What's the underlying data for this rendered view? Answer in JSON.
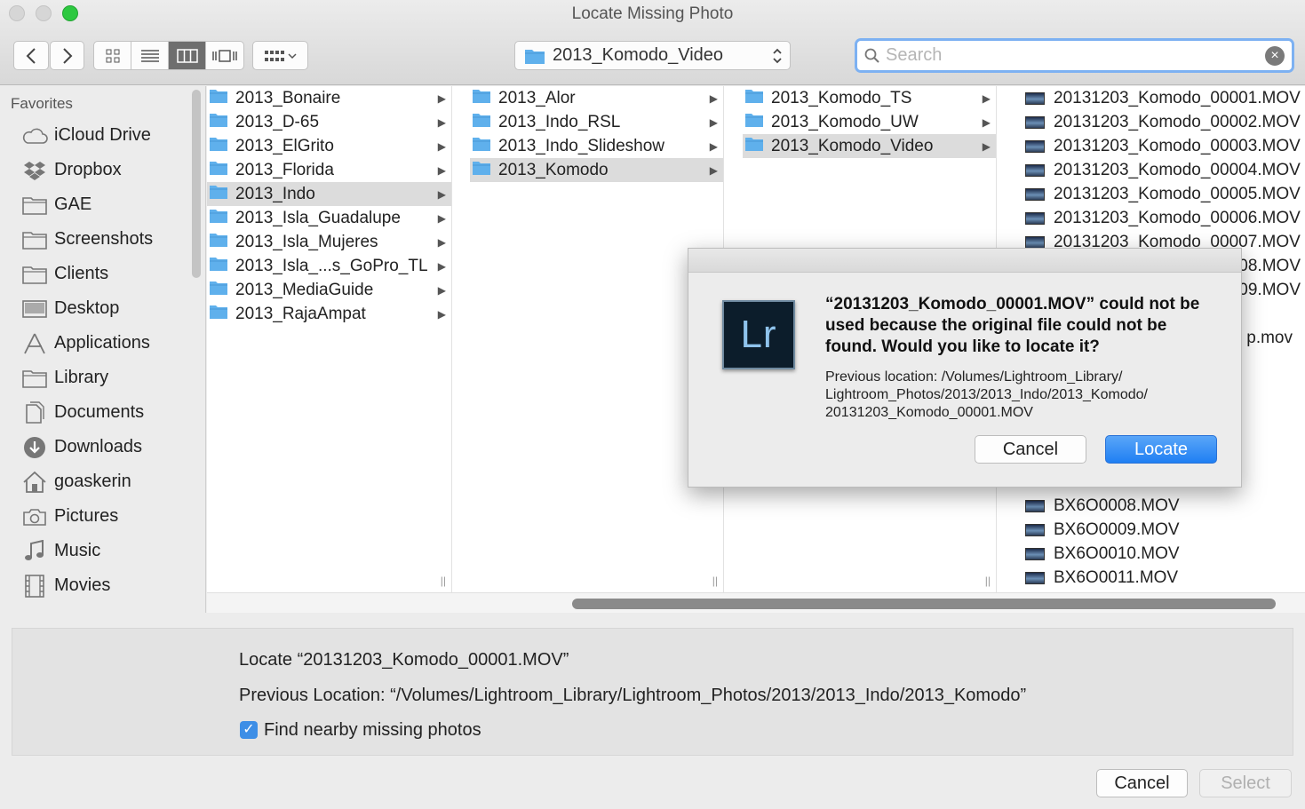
{
  "window": {
    "title": "Locate Missing Photo"
  },
  "toolbar": {
    "back_icon": "chevron-left-icon",
    "forward_icon": "chevron-right-icon",
    "path_popup": "2013_Komodo_Video",
    "search_placeholder": "Search"
  },
  "sidebar": {
    "title": "Favorites",
    "items": [
      {
        "label": "iCloud Drive",
        "icon": "cloud-icon"
      },
      {
        "label": "Dropbox",
        "icon": "dropbox-icon"
      },
      {
        "label": "GAE",
        "icon": "folder-icon"
      },
      {
        "label": "Screenshots",
        "icon": "folder-icon"
      },
      {
        "label": "Clients",
        "icon": "folder-icon"
      },
      {
        "label": "Desktop",
        "icon": "desktop-icon"
      },
      {
        "label": "Applications",
        "icon": "applications-icon"
      },
      {
        "label": "Library",
        "icon": "folder-icon"
      },
      {
        "label": "Documents",
        "icon": "documents-icon"
      },
      {
        "label": "Downloads",
        "icon": "downloads-icon"
      },
      {
        "label": "goaskerin",
        "icon": "home-icon"
      },
      {
        "label": "Pictures",
        "icon": "camera-icon"
      },
      {
        "label": "Music",
        "icon": "music-icon"
      },
      {
        "label": "Movies",
        "icon": "film-icon"
      }
    ]
  },
  "columns": {
    "col1": [
      "2013_Bonaire",
      "2013_D-65",
      "2013_ElGrito",
      "2013_Florida",
      "2013_Indo",
      "2013_Isla_Guadalupe",
      "2013_Isla_Mujeres",
      "2013_Isla_...s_GoPro_TL",
      "2013_MediaGuide",
      "2013_RajaAmpat"
    ],
    "col2": [
      "2013_Alor",
      "2013_Indo_RSL",
      "2013_Indo_Slideshow",
      "2013_Komodo"
    ],
    "col3": [
      "2013_Komodo_TS",
      "2013_Komodo_UW",
      "2013_Komodo_Video"
    ],
    "col4_top": [
      "20131203_Komodo_00001.MOV",
      "20131203_Komodo_00002.MOV",
      "20131203_Komodo_00003.MOV",
      "20131203_Komodo_00004.MOV",
      "20131203_Komodo_00005.MOV",
      "20131203_Komodo_00006.MOV",
      "20131203_Komodo_00007.MOV"
    ],
    "col4_partial": [
      "08.MOV",
      "09.MOV",
      "p.mov"
    ],
    "col4_bottom": [
      "BX6O0008.MOV",
      "BX6O0009.MOV",
      "BX6O0010.MOV",
      "BX6O0011.MOV"
    ],
    "selected": {
      "col1": "2013_Indo",
      "col2": "2013_Komodo",
      "col3": "2013_Komodo_Video"
    }
  },
  "accessory": {
    "locate_line": "Locate “20131203_Komodo_00001.MOV”",
    "previous_line": "Previous Location: “/Volumes/Lightroom_Library/Lightroom_Photos/2013/2013_Indo/2013_Komodo”",
    "checkbox_label": "Find nearby missing photos",
    "checkbox_checked": true
  },
  "panel_buttons": {
    "cancel": "Cancel",
    "select": "Select"
  },
  "alert": {
    "app_icon_text": "Lr",
    "message": "“20131203_Komodo_00001.MOV” could not be used because the original file could not be found. Would you like to locate it?",
    "info_line1": "Previous location: /Volumes/Lightroom_Library/",
    "info_line2": "Lightroom_Photos/2013/2013_Indo/2013_Komodo/",
    "info_line3": "20131203_Komodo_00001.MOV",
    "cancel": "Cancel",
    "locate": "Locate"
  },
  "colors": {
    "accent": "#1f7ff3",
    "folder": "#5fb0ec",
    "selection": "#dcdcdc"
  }
}
